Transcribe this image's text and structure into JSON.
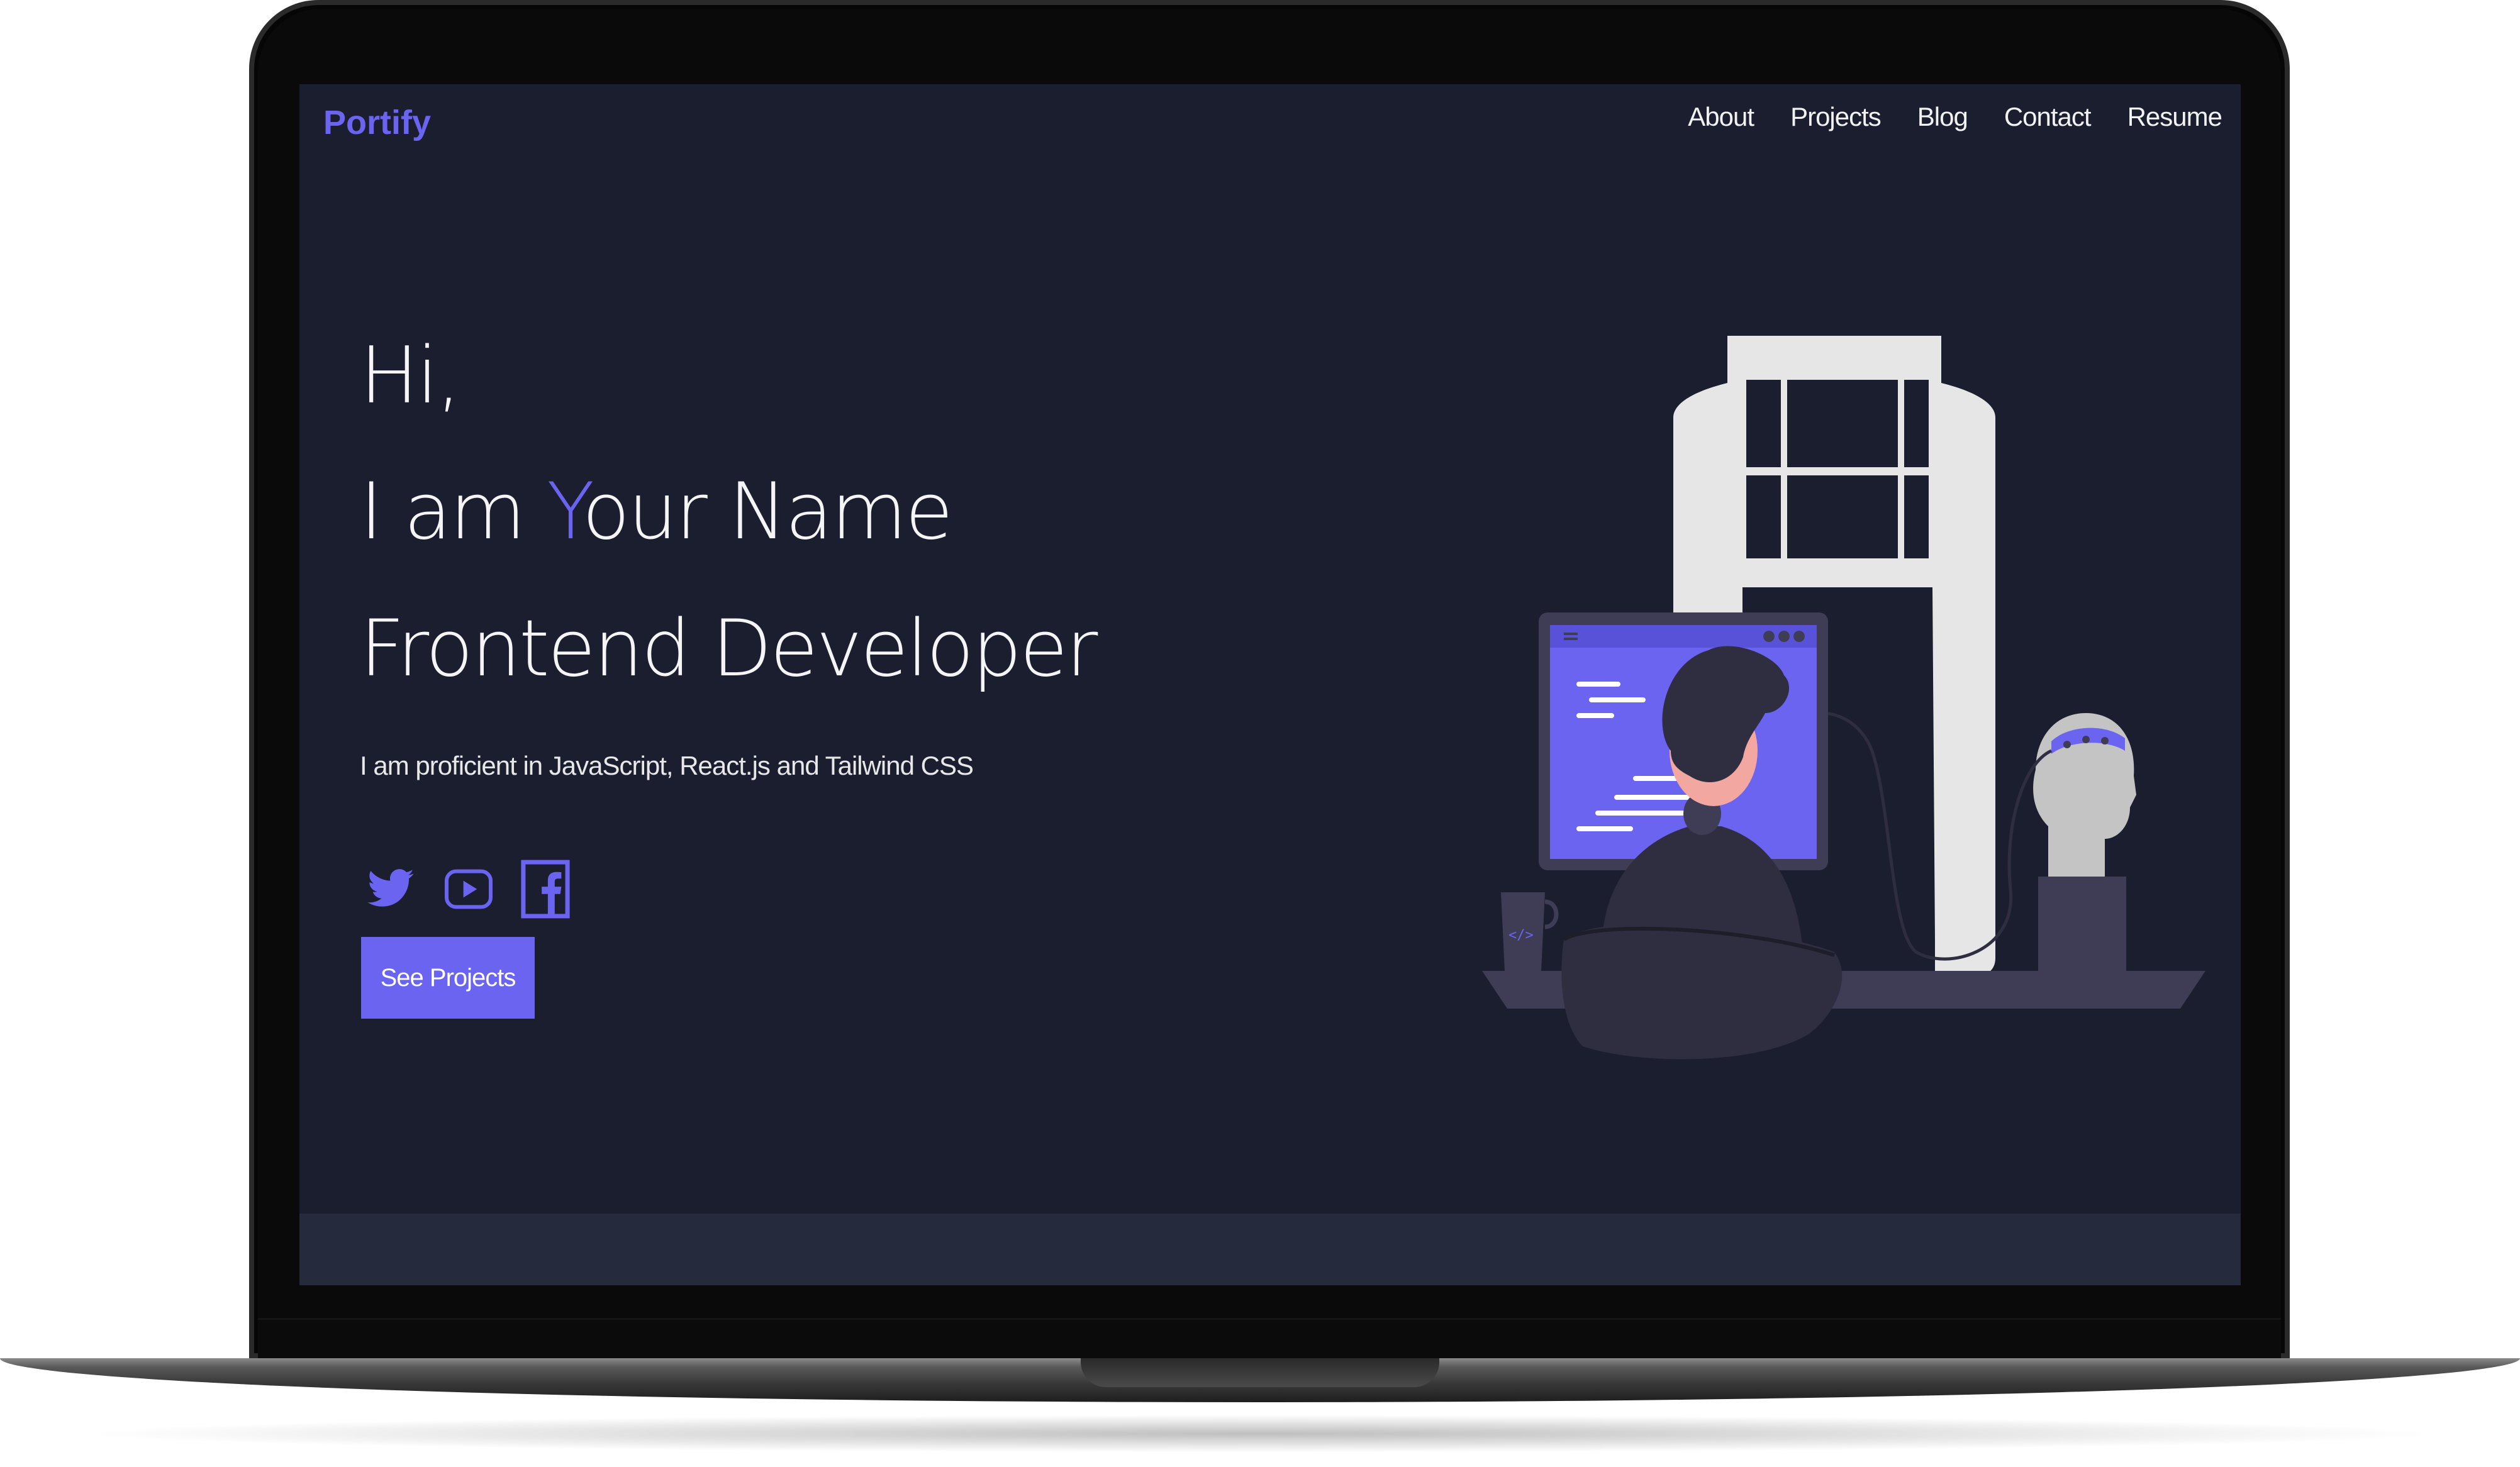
{
  "brand": "Portify",
  "nav": {
    "about": "About",
    "projects": "Projects",
    "blog": "Blog",
    "contact": "Contact",
    "resume": "Resume"
  },
  "hero": {
    "greeting": "Hi,",
    "intro_prefix": "I am ",
    "intro_accent": "Y",
    "intro_rest": "our Name",
    "role": "Frontend Developer",
    "tagline": "I am proficient in JavaScript, React.js and Tailwind CSS",
    "cta_label": "See Projects"
  },
  "socials": [
    "twitter-icon",
    "youtube-icon",
    "facebook-icon"
  ],
  "colors": {
    "background": "#1a1e2e",
    "accent": "#6a64f1",
    "text": "#f5f5f5",
    "footer": "#252a3c"
  }
}
